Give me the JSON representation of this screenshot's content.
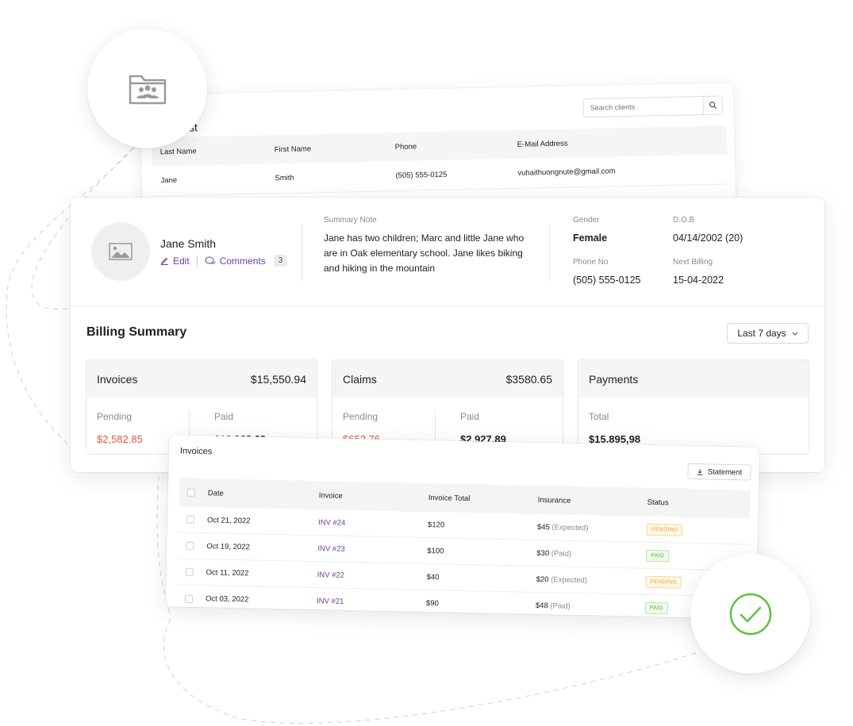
{
  "client_list": {
    "title": "List",
    "search_placeholder": "Search clients",
    "columns": [
      "Last Name",
      "First Name",
      "Phone",
      "E-Mail Address"
    ],
    "rows": [
      {
        "last": "Jane",
        "first": "Smith",
        "phone": "(505) 555-0125",
        "email": "vuhaithuongnute@gmail.com"
      }
    ]
  },
  "profile": {
    "name": "Jane Smith",
    "edit_label": "Edit",
    "comments_label": "Comments",
    "comments_count": "3",
    "summary_label": "Summary Note",
    "summary_text": "Jane has two children; Marc and little Jane who are in Oak elementary school. Jane likes biking and hiking in the mountain",
    "gender_label": "Gender",
    "gender": "Female",
    "dob_label": "D.O.B",
    "dob": "04/14/2002 (20)",
    "phone_label": "Phone No",
    "phone": "(505) 555-0125",
    "next_billing_label": "Next Billing",
    "next_billing": "15-04-2022"
  },
  "billing": {
    "title": "Billing Summary",
    "range": "Last 7 days",
    "invoices": {
      "title": "Invoices",
      "total": "$15,550.94",
      "pending_label": "Pending",
      "pending": "$2,582.85",
      "paid_label": "Paid",
      "paid": "$12.968,09"
    },
    "claims": {
      "title": "Claims",
      "total": "$3580.65",
      "pending_label": "Pending",
      "pending": "$652.76",
      "paid_label": "Paid",
      "paid": "$2.927,89"
    },
    "payments": {
      "title": "Payments",
      "total_label": "Total",
      "total": "$15.895,98"
    }
  },
  "invoices_table": {
    "title": "Invoices",
    "statement_label": "Statement",
    "columns": [
      "Date",
      "Invoice",
      "Invoice Total",
      "Insurance",
      "Status"
    ],
    "rows": [
      {
        "date": "Oct 21, 2022",
        "invoice": "INV #24",
        "total": "$120",
        "insurance": "$45",
        "insurance_note": "(Expected)",
        "status": "PENDING"
      },
      {
        "date": "Oct 19, 2022",
        "invoice": "INV #23",
        "total": "$100",
        "insurance": "$30",
        "insurance_note": "(Paid)",
        "status": "PAID"
      },
      {
        "date": "Oct 11, 2022",
        "invoice": "INV #22",
        "total": "$40",
        "insurance": "$20",
        "insurance_note": "(Expected)",
        "status": "PENDING"
      },
      {
        "date": "Oct 03, 2022",
        "invoice": "INV #21",
        "total": "$90",
        "insurance": "$48",
        "insurance_note": "(Paid)",
        "status": "PAID"
      }
    ]
  },
  "colors": {
    "accent": "#6b3fa0",
    "danger": "#e8553e",
    "success": "#4caf3a",
    "warning": "#e8a33e"
  },
  "icons": [
    "client-folder-icon",
    "search-icon",
    "image-placeholder-icon",
    "edit-icon",
    "comments-icon",
    "chevron-down-icon",
    "download-icon",
    "check-circle-icon"
  ]
}
